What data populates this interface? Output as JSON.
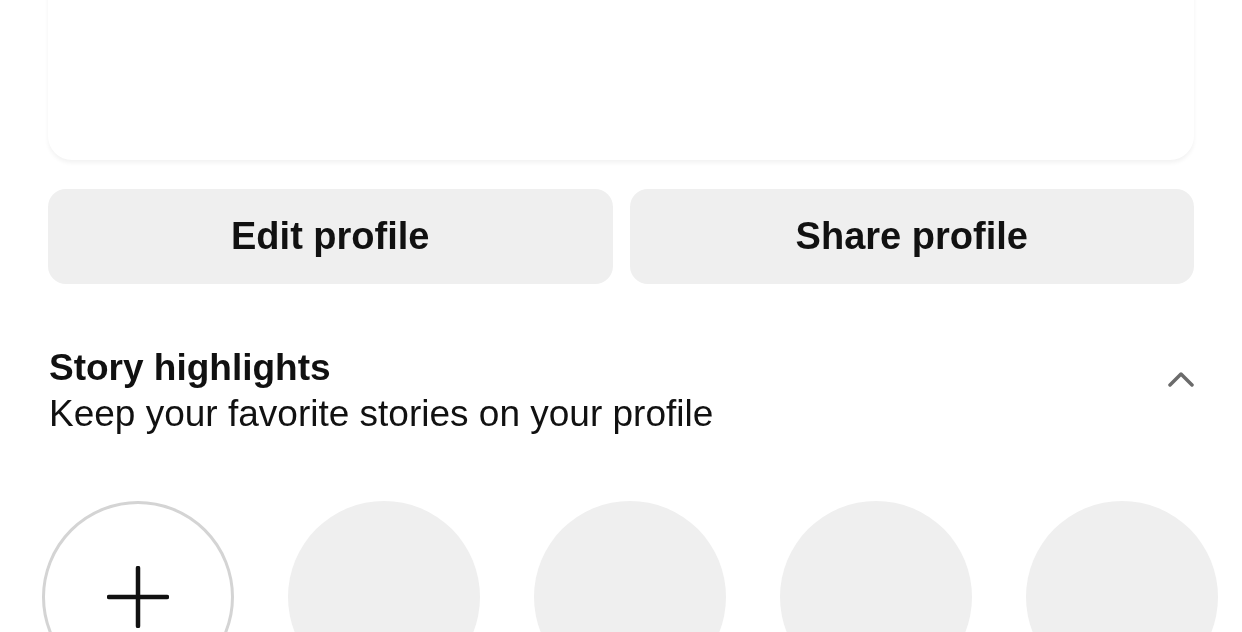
{
  "profile_actions": [
    {
      "label": "Edit profile"
    },
    {
      "label": "Share profile"
    }
  ],
  "story_highlights": {
    "title": "Story highlights",
    "subtitle": "Keep your favorite stories on your profile",
    "expanded": true,
    "items": [
      {
        "kind": "new"
      },
      {
        "kind": "placeholder"
      },
      {
        "kind": "placeholder"
      },
      {
        "kind": "placeholder"
      },
      {
        "kind": "placeholder"
      }
    ]
  }
}
